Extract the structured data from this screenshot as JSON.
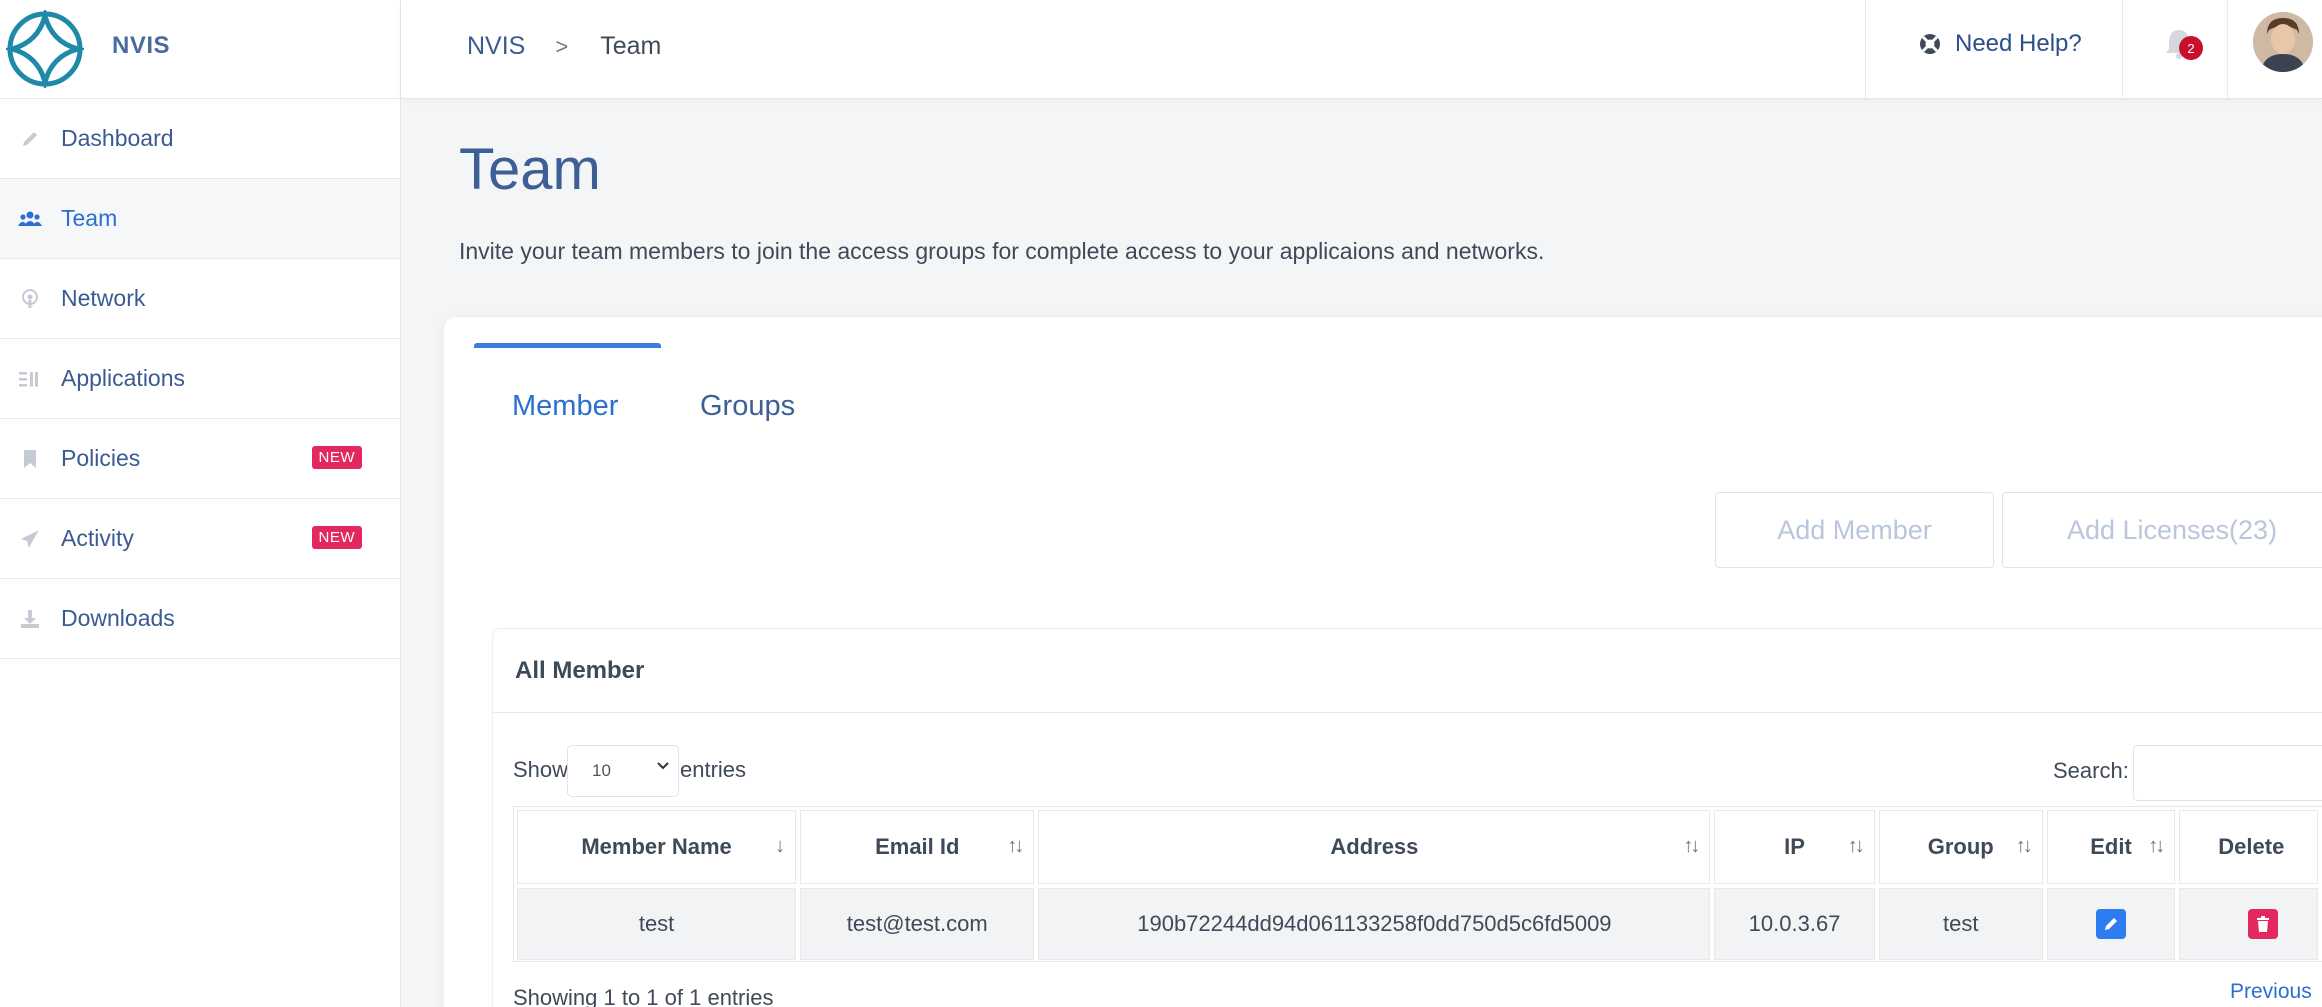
{
  "brand": {
    "name": "NVIS"
  },
  "sidebar": {
    "items": [
      {
        "label": "Dashboard",
        "icon": "pencil-icon"
      },
      {
        "label": "Team",
        "icon": "users-icon",
        "active": true
      },
      {
        "label": "Network",
        "icon": "podcast-icon"
      },
      {
        "label": "Applications",
        "icon": "list-icon"
      },
      {
        "label": "Policies",
        "icon": "bookmark-icon",
        "badge": "NEW"
      },
      {
        "label": "Activity",
        "icon": "paper-plane-icon",
        "badge": "NEW"
      },
      {
        "label": "Downloads",
        "icon": "download-icon"
      }
    ]
  },
  "topbar": {
    "breadcrumb_root": "NVIS",
    "breadcrumb_sep": ">",
    "breadcrumb_current": "Team",
    "help_label": "Need Help?",
    "notification_count": "2"
  },
  "page": {
    "title": "Team",
    "description": "Invite your team members to join the access groups for complete access to your applicaions and networks."
  },
  "tabs": {
    "member": "Member",
    "groups": "Groups",
    "active": "Member"
  },
  "actions": {
    "add_member": "Add Member",
    "add_licenses": "Add Licenses(23)"
  },
  "members_table": {
    "title": "All Member",
    "show_label": "Show",
    "entries_value": "10",
    "entries_label": "entries",
    "search_label": "Search:",
    "columns": [
      "Member Name",
      "Email Id",
      "Address",
      "IP",
      "Group",
      "Edit",
      "Delete"
    ],
    "rows": [
      {
        "name": "test",
        "email": "test@test.com",
        "address": "190b72244dd94d061133258f0dd750d5c6fd5009",
        "ip": "10.0.3.67",
        "group": "test"
      }
    ],
    "summary": "Showing 1 to 1 of 1 entries",
    "pagination_prev": "Previous"
  },
  "colors": {
    "accent": "#2c6fd1",
    "brand": "#3e5f95",
    "badge": "#e2285f",
    "notification": "#c8102e"
  }
}
